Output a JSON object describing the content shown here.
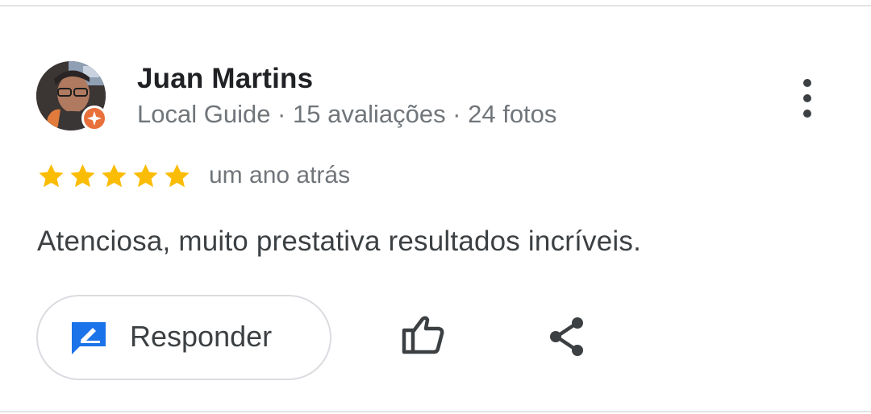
{
  "review": {
    "author": {
      "name": "Juan Martins",
      "meta": "Local Guide · 15 avaliações · 24 fotos",
      "avatar_icon": "user-photo",
      "badge_icon": "local-guide-star-icon"
    },
    "rating": {
      "stars": 5,
      "max": 5,
      "color": "#fbbc04"
    },
    "time_ago": "um ano atrás",
    "text": "Atenciosa, muito prestativa resultados incríveis."
  },
  "actions": {
    "reply_label": "Responder",
    "reply_icon": "reply-edit-icon",
    "like_icon": "thumbs-up-icon",
    "share_icon": "share-icon",
    "more_icon": "more-vert-icon"
  },
  "colors": {
    "accent_blue": "#1a73e8",
    "guide_orange": "#e8703a",
    "star_yellow": "#fbbc04"
  }
}
